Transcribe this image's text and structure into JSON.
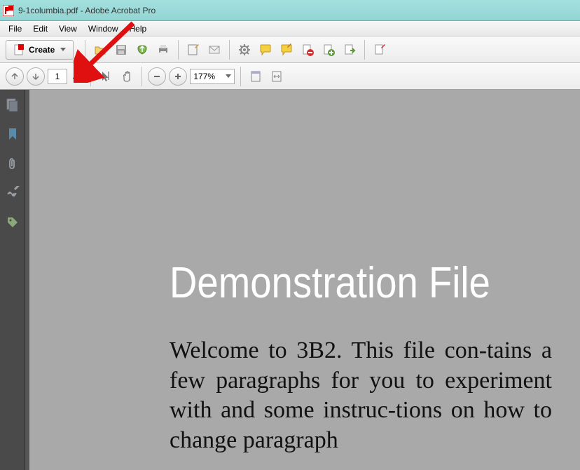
{
  "titlebar": {
    "filename": "9-1columbia.pdf",
    "appname": "Adobe Acrobat Pro"
  },
  "menu": {
    "file": "File",
    "edit": "Edit",
    "view": "View",
    "window": "Window",
    "help": "Help"
  },
  "toolbar": {
    "create": "Create"
  },
  "pagenav": {
    "current": "1",
    "total": "/ 5"
  },
  "zoom": {
    "level": "177%"
  },
  "document": {
    "heading": "Demonstration File",
    "body": "Welcome to 3B2. This file con-tains a few paragraphs for you to experiment with and some instruc-tions on how to change paragraph"
  }
}
